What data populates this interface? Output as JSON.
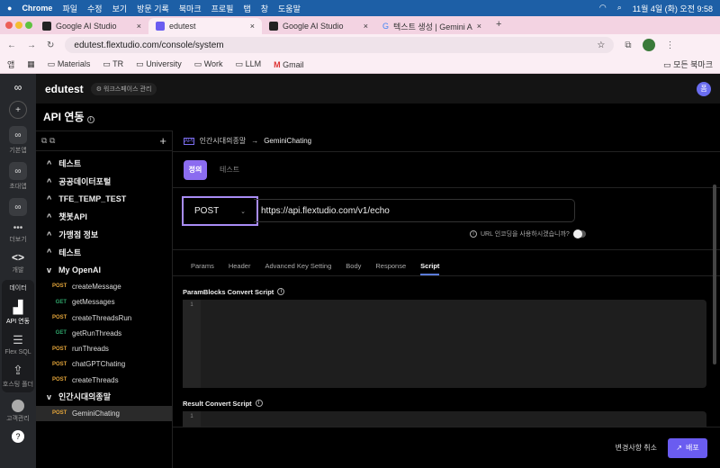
{
  "menubar": {
    "app": "Chrome",
    "items": [
      "파일",
      "수정",
      "보기",
      "방문 기록",
      "북마크",
      "프로필",
      "탭",
      "창",
      "도움말"
    ],
    "clock": "11월 4일 (화) 오전 9:58"
  },
  "browser": {
    "tabs": [
      {
        "title": "Google AI Studio"
      },
      {
        "title": "edutest"
      },
      {
        "title": "Google AI Studio"
      },
      {
        "title": "텍스트 생성 | Gemini API | Go"
      }
    ],
    "url": "edutest.flextudio.com/console/system",
    "bookmarks": [
      "앱",
      "Materials",
      "TR",
      "University",
      "Work",
      "LLM",
      "Gmail"
    ],
    "all_bookmarks": "모든 북마크"
  },
  "rail": {
    "items": [
      "기본앱",
      "초대앱",
      "더보기",
      "개발"
    ],
    "data_group": "데이터",
    "data_items": [
      "API 연동",
      "Flex SQL",
      "호스팅 폴더"
    ],
    "customer": "고객관리",
    "help": "?"
  },
  "header": {
    "workspace": "edutest",
    "workspace_manage": "워크스페이스 관리",
    "avatar": "폼"
  },
  "page_title": "API 연동",
  "sidebar": {
    "groups": [
      {
        "label": "테스트",
        "open": false
      },
      {
        "label": "공공데이터포털",
        "open": false
      },
      {
        "label": "TFE_TEMP_TEST",
        "open": false
      },
      {
        "label": "챗봇API",
        "open": false
      },
      {
        "label": "가맹점 정보",
        "open": false
      },
      {
        "label": "테스트",
        "open": false
      }
    ],
    "open_group": {
      "label": "My OpenAI",
      "items": [
        {
          "method": "POST",
          "name": "createMessage"
        },
        {
          "method": "GET",
          "name": "getMessages"
        },
        {
          "method": "POST",
          "name": "createThreadsRun"
        },
        {
          "method": "GET",
          "name": "getRunThreads"
        },
        {
          "method": "POST",
          "name": "runThreads"
        },
        {
          "method": "POST",
          "name": "chatGPTChating"
        },
        {
          "method": "POST",
          "name": "createThreads"
        }
      ]
    },
    "open_group2": {
      "label": "인간시대의종말",
      "items": [
        {
          "method": "POST",
          "name": "GeminiChating"
        }
      ]
    }
  },
  "breadcrumb": {
    "badge": "API",
    "parent": "인간시대의종말",
    "current": "GeminiChating"
  },
  "def_tabs": {
    "definition": "정의",
    "test": "테스트"
  },
  "request": {
    "method": "POST",
    "url": "https://api.flextudio.com/v1/echo",
    "encoding_label": "URL 인코딩을 사용하시겠습니까?",
    "encoding_on": false
  },
  "sub_tabs": [
    "Params",
    "Header",
    "Advanced Key Setting",
    "Body",
    "Response",
    "Script"
  ],
  "active_sub_tab": "Script",
  "scripts": {
    "param_label": "ParamBlocks Convert Script",
    "result_label": "Result Convert Script",
    "line": "1"
  },
  "footer": {
    "cancel": "변경사항 취소",
    "deploy": "배포"
  }
}
